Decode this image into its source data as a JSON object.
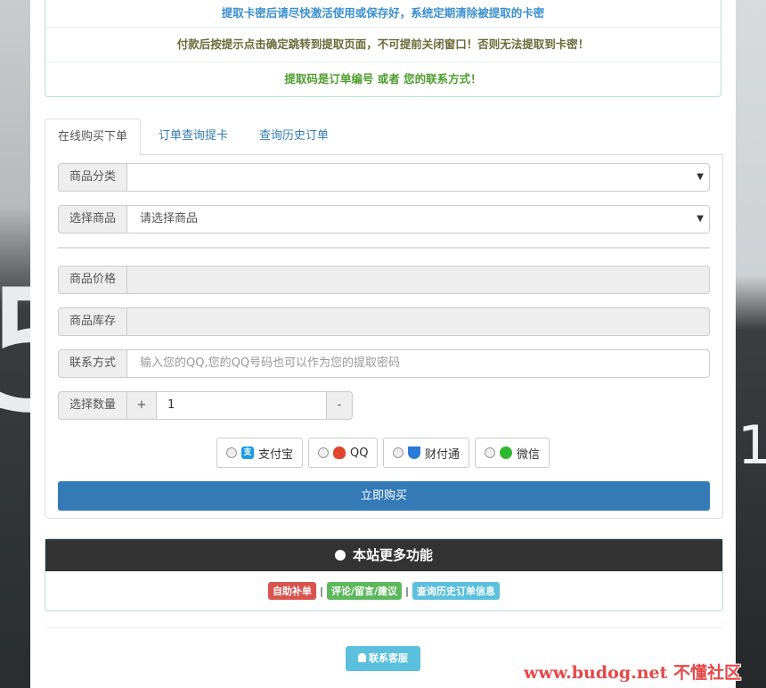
{
  "notice": {
    "line1": "提取卡密后请尽快激活使用或保存好，系统定期清除被提取的卡密",
    "line2": "付款后按提示点击确定跳转到提取页面，不可提前关闭窗口！否则无法提取到卡密！",
    "line3": "提取码是订单编号 或者 您的联系方式！"
  },
  "tabs": [
    "在线购买下单",
    "订单查询提卡",
    "查询历史订单"
  ],
  "form": {
    "category_label": "商品分类",
    "category_value": "",
    "product_label": "选择商品",
    "product_value": "请选择商品",
    "price_label": "商品价格",
    "stock_label": "商品库存",
    "contact_label": "联系方式",
    "contact_placeholder": "输入您的QQ,您的QQ号码也可以作为您的提取密码",
    "qty_label": "选择数量",
    "qty_plus": "+",
    "qty_value": "1",
    "qty_minus": "-"
  },
  "payments": [
    {
      "label": "支付宝",
      "icon": "alipay-icon",
      "color": "#1a9be6"
    },
    {
      "label": "QQ",
      "icon": "qq-penguin-icon",
      "color": "#e0452b"
    },
    {
      "label": "财付通",
      "icon": "tenpay-icon",
      "color": "#2a7bd4"
    },
    {
      "label": "微信",
      "icon": "wechat-icon",
      "color": "#2eb82e"
    }
  ],
  "buy_button": "立即购买",
  "features": {
    "title": "本站更多功能",
    "links": [
      {
        "label": "自助补单",
        "color": "#d9534f"
      },
      {
        "label": "评论/留言/建议",
        "color": "#5cb85c"
      },
      {
        "label": "查询历史订单信息",
        "color": "#5bc0de"
      }
    ],
    "separator": "|"
  },
  "contact_button": "联系客服",
  "watermark": "www.budog.net 不懂社区",
  "colors": {
    "primary": "#337ab7",
    "info": "#5bc0de",
    "header_dark": "#333333"
  }
}
